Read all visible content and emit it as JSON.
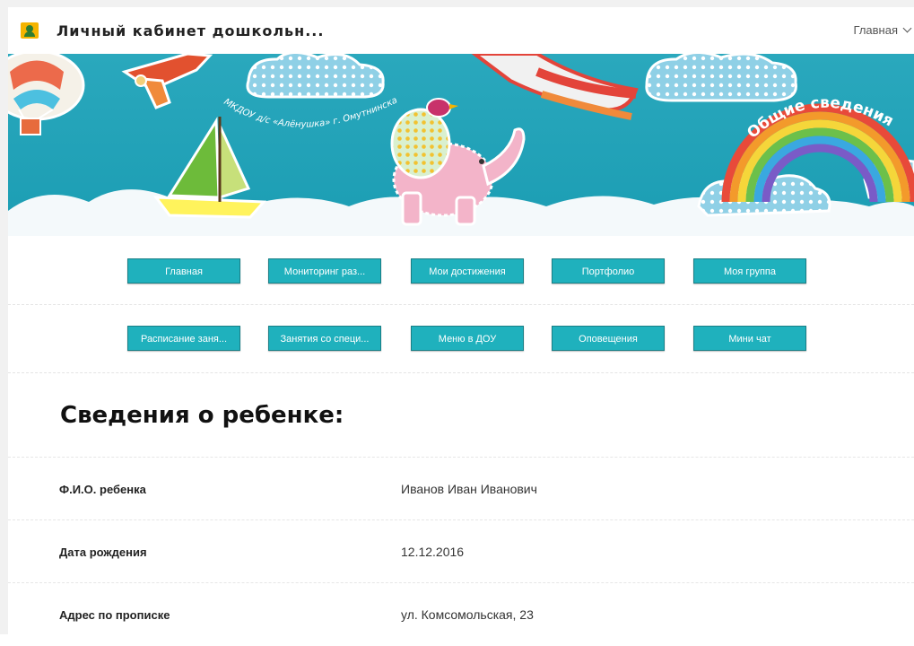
{
  "header": {
    "title": "Личный кабинет дошкольн...",
    "home_menu_label": "Главная"
  },
  "banner": {
    "arc_text": "МКДОУ д/с «Алёнушка» г. Омутнинска",
    "rainbow_text": "Общие сведения"
  },
  "nav": {
    "row1": [
      "Главная",
      "Мониторинг раз...",
      "Мои достижения",
      "Портфолио",
      "Моя группа"
    ],
    "row2": [
      "Расписание заня...",
      "Занятия со специ...",
      "Меню в ДОУ",
      "Оповещения",
      "Мини чат"
    ]
  },
  "section": {
    "title": "Сведения о ребенке:"
  },
  "info": [
    {
      "label": "Ф.И.О. ребенка",
      "value": "Иванов Иван Иванович"
    },
    {
      "label": "Дата рождения",
      "value": "12.12.2016"
    },
    {
      "label": "Адрес по прописке",
      "value": "ул. Комсомольская, 23"
    }
  ],
  "colors": {
    "button": "#1fb1bd",
    "banner_sky": "#1b9db3",
    "app_icon": "#f5b400"
  }
}
